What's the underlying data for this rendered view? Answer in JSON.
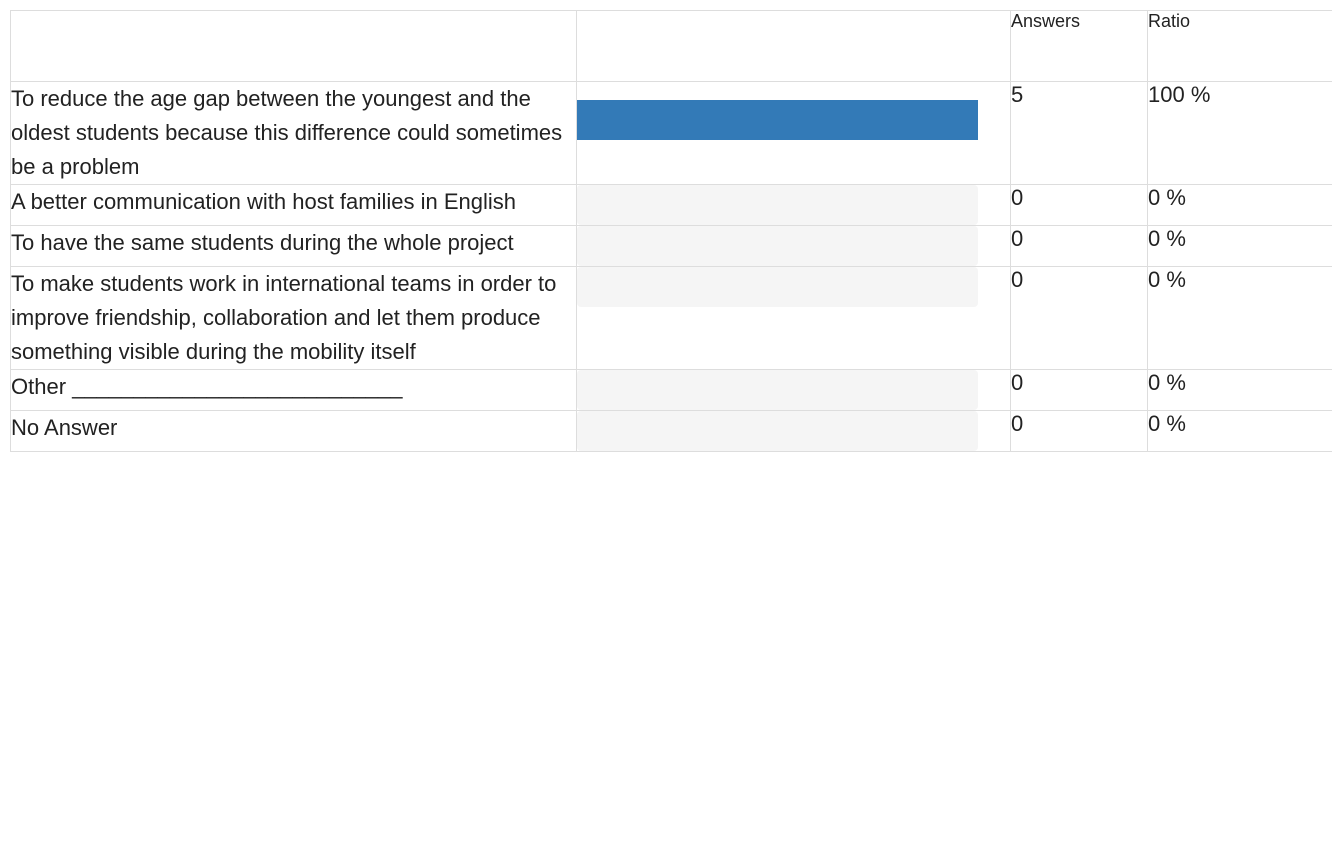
{
  "table": {
    "headers": {
      "label": "",
      "bar": "",
      "answers": "Answers",
      "ratio": "Ratio"
    },
    "rows": [
      {
        "label": "To reduce the age gap between the youngest and the oldest students because this difference could sometimes be a problem",
        "answers": "5",
        "ratio": "100 %",
        "fraction": 1.0
      },
      {
        "label": "A better communication with host families in English",
        "answers": "0",
        "ratio": "0 %",
        "fraction": 0
      },
      {
        "label": "To have the same students during the whole project",
        "answers": "0",
        "ratio": "0 %",
        "fraction": 0
      },
      {
        "label": "To make students work in international teams in order to improve friendship, collaboration and let them produce something visible during the mobility itself",
        "answers": "0",
        "ratio": "0 %",
        "fraction": 0
      },
      {
        "label": "Other ___________________________",
        "answers": "0",
        "ratio": "0 %",
        "fraction": 0
      },
      {
        "label": "No Answer",
        "answers": "0",
        "ratio": "0 %",
        "fraction": 0
      }
    ]
  },
  "colors": {
    "bar_fill": "#337ab7",
    "bar_track": "#f5f5f5",
    "border": "#dddddd"
  }
}
